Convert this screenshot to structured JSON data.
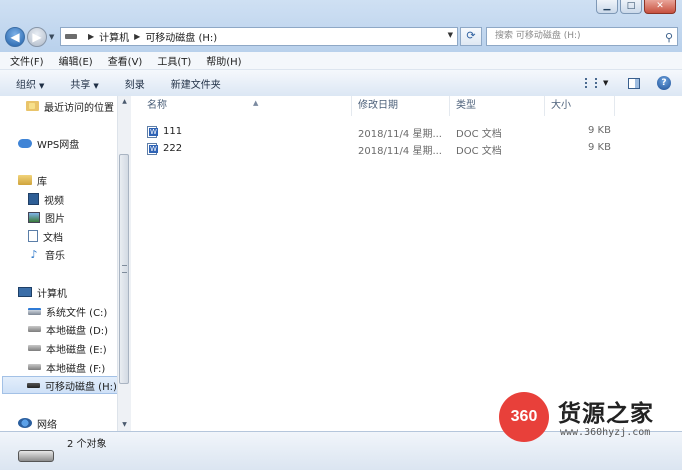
{
  "window": {
    "minimize": "▁",
    "maximize": "□",
    "close": "✕"
  },
  "address": {
    "crumbs": [
      "计算机",
      "可移动磁盘 (H:)"
    ],
    "search_placeholder": "搜索 可移动磁盘 (H:)"
  },
  "menu": [
    "文件(F)",
    "编辑(E)",
    "查看(V)",
    "工具(T)",
    "帮助(H)"
  ],
  "toolbar": {
    "organize": "组织",
    "share": "共享",
    "burn": "刻录",
    "new_folder": "新建文件夹",
    "help": "?"
  },
  "nav": {
    "recent": "最近访问的位置",
    "wps": "WPS网盘",
    "library": "库",
    "video": "视频",
    "pictures": "图片",
    "documents": "文档",
    "music": "音乐",
    "computer": "计算机",
    "drive_c": "系统文件 (C:)",
    "drive_d": "本地磁盘 (D:)",
    "drive_e": "本地磁盘 (E:)",
    "drive_f": "本地磁盘 (F:)",
    "drive_h": "可移动磁盘 (H:)",
    "network": "网络"
  },
  "columns": {
    "name": "名称",
    "modified": "修改日期",
    "type": "类型",
    "size": "大小"
  },
  "files": [
    {
      "name": "111",
      "modified": "2018/11/4 星期...",
      "type": "DOC 文档",
      "size": "9 KB"
    },
    {
      "name": "222",
      "modified": "2018/11/4 星期...",
      "type": "DOC 文档",
      "size": "9 KB"
    }
  ],
  "status": {
    "count": "2 个对象"
  },
  "watermark": {
    "badge": "360",
    "title": "货源之家",
    "url": "www.360hyzj.com"
  }
}
